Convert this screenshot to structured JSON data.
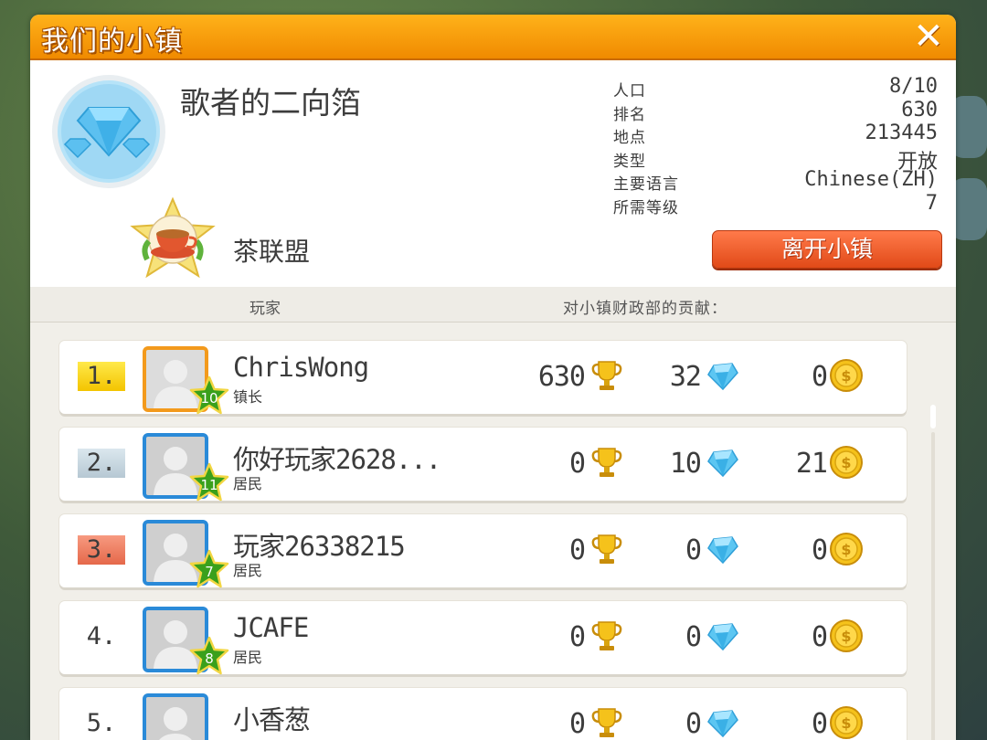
{
  "window": {
    "title": "我们的小镇",
    "close": "✕"
  },
  "town": {
    "name": "歌者的二向箔",
    "stats": [
      {
        "label": "人口",
        "value": "8/10"
      },
      {
        "label": "排名",
        "value": "630"
      },
      {
        "label": "地点",
        "value": "213445"
      },
      {
        "label": "类型",
        "value": "开放"
      },
      {
        "label": "主要语言",
        "value": "Chinese(ZH)"
      },
      {
        "label": "所需等级",
        "value": "7"
      }
    ],
    "alliance": "茶联盟",
    "leave_button": "离开小镇"
  },
  "table": {
    "header_player": "玩家",
    "header_contribution": "对小镇财政部的贡献："
  },
  "players": [
    {
      "rank": "1.",
      "name": "ChrisWong",
      "role": "镇长",
      "level": "10",
      "trophies": "630",
      "diamonds": "32",
      "coins": "0"
    },
    {
      "rank": "2.",
      "name": "你好玩家2628...",
      "role": "居民",
      "level": "11",
      "trophies": "0",
      "diamonds": "10",
      "coins": "21"
    },
    {
      "rank": "3.",
      "name": "玩家26338215",
      "role": "居民",
      "level": "7",
      "trophies": "0",
      "diamonds": "0",
      "coins": "0"
    },
    {
      "rank": "4.",
      "name": "JCAFE",
      "role": "居民",
      "level": "8",
      "trophies": "0",
      "diamonds": "0",
      "coins": "0"
    },
    {
      "rank": "5.",
      "name": "小香葱",
      "role": "",
      "level": "",
      "trophies": "0",
      "diamonds": "0",
      "coins": "0"
    }
  ],
  "colors": {
    "title_bar": "#f39a0c",
    "leave_button": "#e9562a",
    "rank_gold": "#f7d200",
    "rank_silver": "#c3d4de",
    "rank_bronze": "#ee7a5e",
    "avatar_border": "#2a8ad8",
    "mayor_border": "#f39a1c",
    "level_star": "#3aa01c"
  }
}
